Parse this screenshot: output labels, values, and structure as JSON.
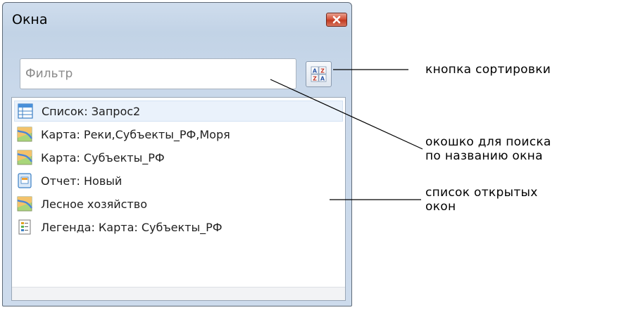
{
  "window": {
    "title": "Окна",
    "close_label": "×"
  },
  "filter": {
    "placeholder": "Фильтр",
    "value": ""
  },
  "sort_button": {
    "icon": "sort-az-icon"
  },
  "list": {
    "items": [
      {
        "icon": "table-list-icon",
        "label": "Список: Запрос2",
        "selected": true
      },
      {
        "icon": "map-icon",
        "label": "Карта: Реки,Субъекты_РФ,Моря",
        "selected": false
      },
      {
        "icon": "map-icon",
        "label": "Карта: Субъекты_РФ",
        "selected": false
      },
      {
        "icon": "report-icon",
        "label": "Отчет: Новый",
        "selected": false
      },
      {
        "icon": "map-icon",
        "label": "Лесное хозяйство",
        "selected": false
      },
      {
        "icon": "legend-icon",
        "label": "Легенда: Карта: Субъекты_РФ",
        "selected": false
      }
    ]
  },
  "annotations": {
    "sort_button": "кнопка сортировки",
    "filter_line1": "окошко для поиска",
    "filter_line2": "по названию окна",
    "list_line1": "список открытых",
    "list_line2": "окон"
  }
}
